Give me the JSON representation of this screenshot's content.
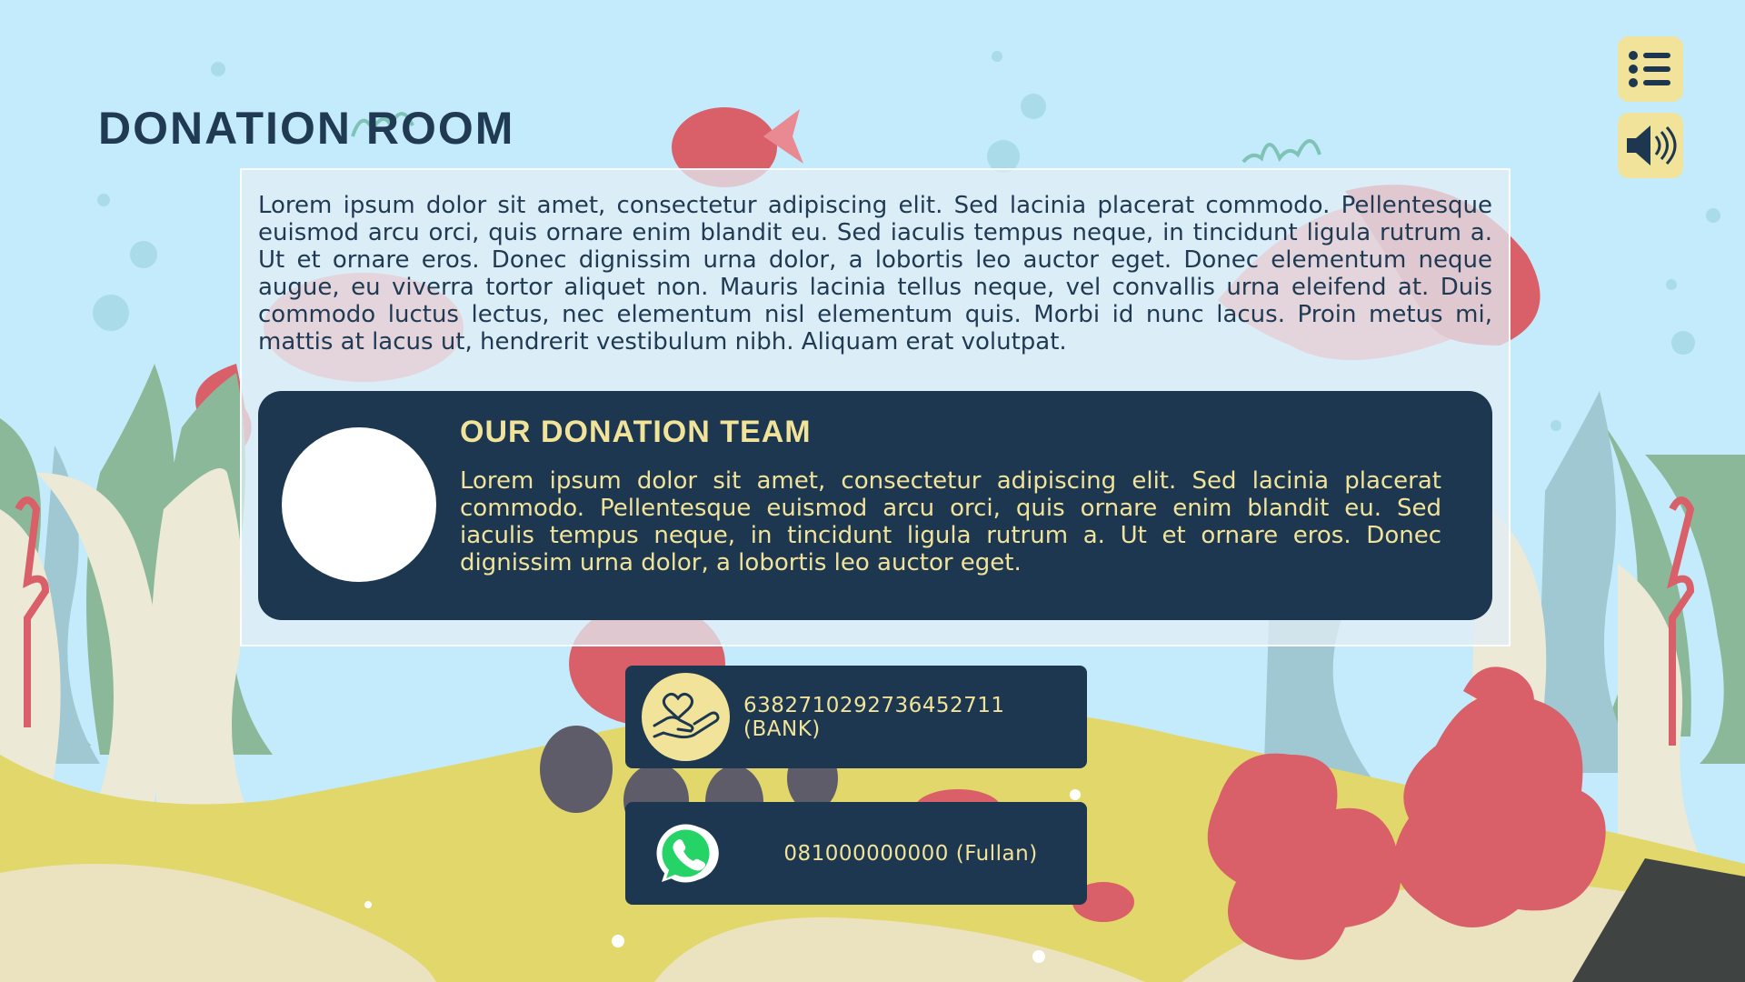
{
  "page": {
    "title": "DONATION ROOM",
    "intro_text": "Lorem ipsum dolor sit amet, consectetur adipiscing elit. Sed lacinia placerat commodo. Pellentesque euismod arcu orci, quis ornare enim blandit eu. Sed iaculis tempus neque, in tincidunt ligula rutrum a. Ut et ornare eros. Donec dignissim urna dolor, a lobortis leo auctor eget. Donec elementum neque augue, eu viverra tortor aliquet non. Mauris lacinia tellus neque, vel convallis urna eleifend at. Duis commodo luctus lectus, nec elementum nisl elementum quis. Morbi id nunc lacus. Proin metus mi, mattis at lacus ut, hendrerit vestibulum nibh. Aliquam erat volutpat."
  },
  "team": {
    "heading": "OUR DONATION TEAM",
    "description": "Lorem ipsum dolor sit amet, consectetur adipiscing elit. Sed lacinia placerat commodo. Pellentesque euismod arcu orci, quis ornare enim blandit eu. Sed iaculis tempus neque, in tincidunt ligula rutrum a. Ut et ornare eros. Donec dignissim urna dolor, a lobortis leo auctor eget."
  },
  "contacts": {
    "bank": {
      "text": "6382710292736452711 (BANK)",
      "icon": "donate-hand-heart-icon"
    },
    "whatsapp": {
      "text": "081000000000 (Fullan)",
      "icon": "whatsapp-icon"
    }
  },
  "toolbar": {
    "menu_icon": "menu-list-icon",
    "sound_icon": "speaker-volume-icon"
  },
  "colors": {
    "water": "#c3ebfb",
    "navy": "#1c374f",
    "title": "#1f3a52",
    "accent_yellow": "#f2e39a",
    "coral": "#d95f69",
    "sand": "#e2d76a",
    "pale_sand": "#ebe2bf",
    "seaweed_green": "#8cb89a",
    "seaweed_cream": "#ece9d6"
  }
}
